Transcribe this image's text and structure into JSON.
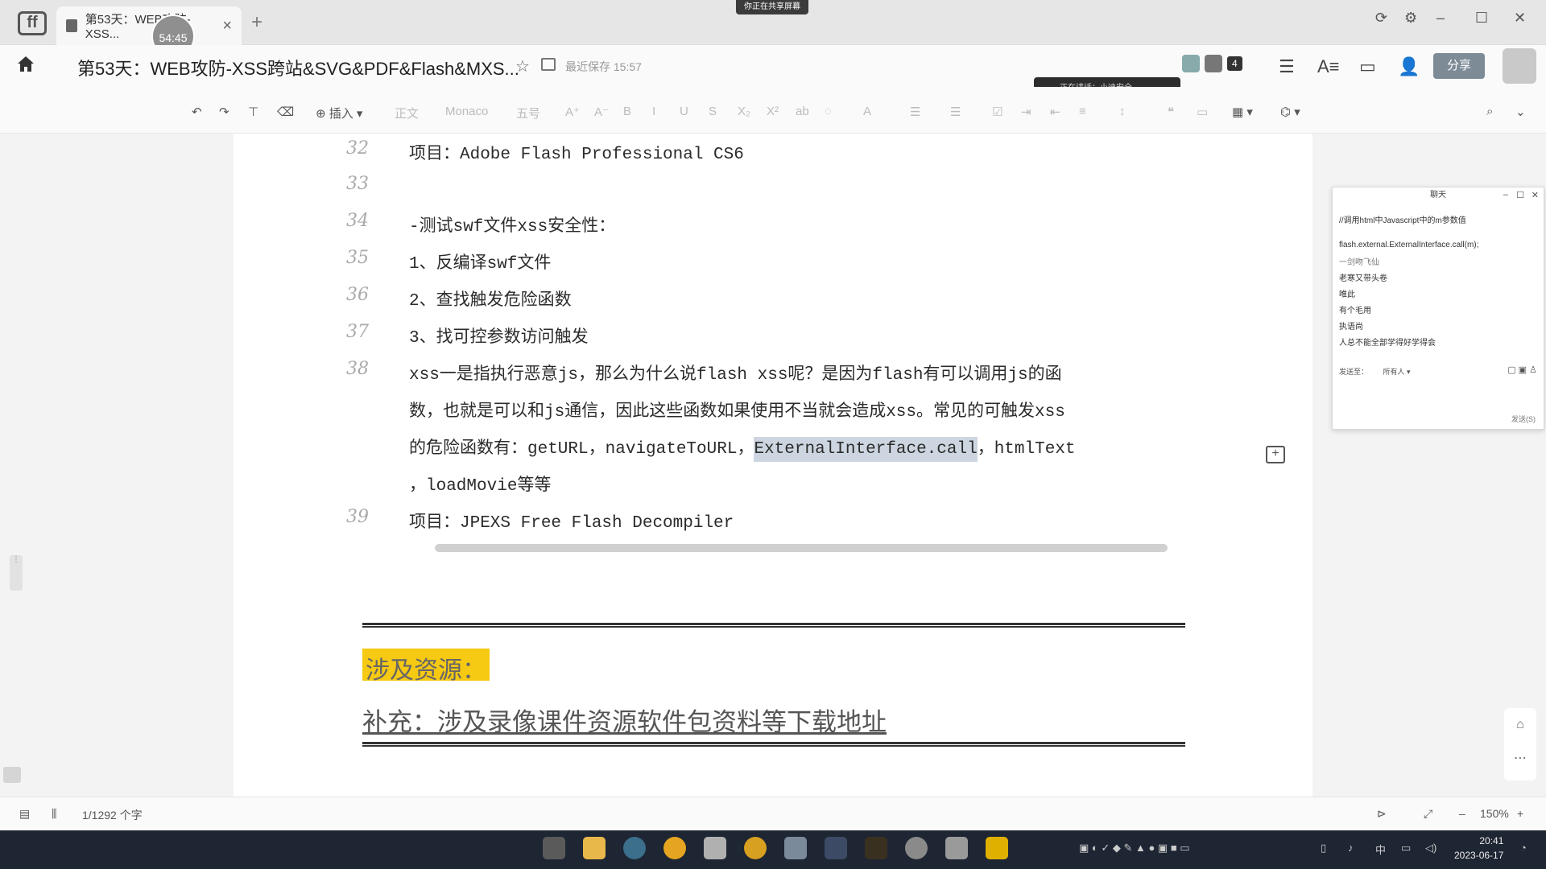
{
  "tabbar": {
    "tab_title": "第53天：WEB攻防-XSS...",
    "avatar_badge": "54:45",
    "share_banner": "你正在共享屏幕"
  },
  "header": {
    "doc_title": "第53天：WEB攻防-XSS跨站&SVG&PDF&Flash&MXS...",
    "saved_status": "最近保存 15:57",
    "meeting_status": "正在讲话：小迪安全",
    "collab_count": "4",
    "share_label": "分享"
  },
  "toolbar": {
    "insert_label": "插入",
    "style_label": "正文",
    "font_label": "Monaco",
    "size_label": "五号"
  },
  "document": {
    "lines": [
      {
        "no": "32",
        "text": "项目：Adobe Flash Professional CS6"
      },
      {
        "no": "33",
        "text": ""
      },
      {
        "no": "34",
        "text": "-测试swf文件xss安全性："
      },
      {
        "no": "35",
        "text": "1、反编译swf文件"
      },
      {
        "no": "36",
        "text": "2、查找触发危险函数"
      },
      {
        "no": "37",
        "text": "3、找可控参数访问触发"
      },
      {
        "no": "38",
        "text": "xss一是指执行恶意js，那么为什么说flash xss呢？是因为flash有可以调用js的函"
      },
      {
        "no": "",
        "text": "数，也就是可以和js通信，因此这些函数如果使用不当就会造成xss。常见的可触发xss"
      },
      {
        "no": "",
        "text_before": "的危险函数有：getURL，navigateToURL，",
        "highlight": "ExternalInterface.call",
        "text_after": "，htmlText"
      },
      {
        "no": "",
        "text": "，loadMovie等等"
      },
      {
        "no": "39",
        "text": "项目：JPEXS Free Flash Decompiler"
      }
    ],
    "section_label": "涉及资源：",
    "supplement_link": "补充：涉及录像课件资源软件包资料等下载地址"
  },
  "chat": {
    "title": "聊天",
    "messages": [
      "//调用html中Javascript中的m参数值",
      "flash.external.ExternalInterface.call(m);",
      "一剑吻飞仙",
      "老寒又带头卷",
      "唯此",
      "有个毛用",
      "执语尚",
      "人总不能全部学得好学得会"
    ],
    "send_to_label": "发送至：",
    "send_to_value": "所有人",
    "send_button": "发送(S)"
  },
  "statusbar": {
    "word_count": "1/1292 个字",
    "zoom": "150%"
  },
  "clock": {
    "time": "20:41",
    "date": "2023-06-17"
  },
  "colors": {
    "highlight_bg": "#cdd6e0",
    "section_label_bg": "#f6c913",
    "taskbar_bg": "#1e2533"
  },
  "icons": [
    "home-icon",
    "star-icon",
    "folder-icon",
    "undo-icon",
    "redo-icon",
    "format-painter-icon",
    "eraser-icon",
    "search-icon",
    "comment-icon",
    "play-icon",
    "fullscreen-icon"
  ]
}
